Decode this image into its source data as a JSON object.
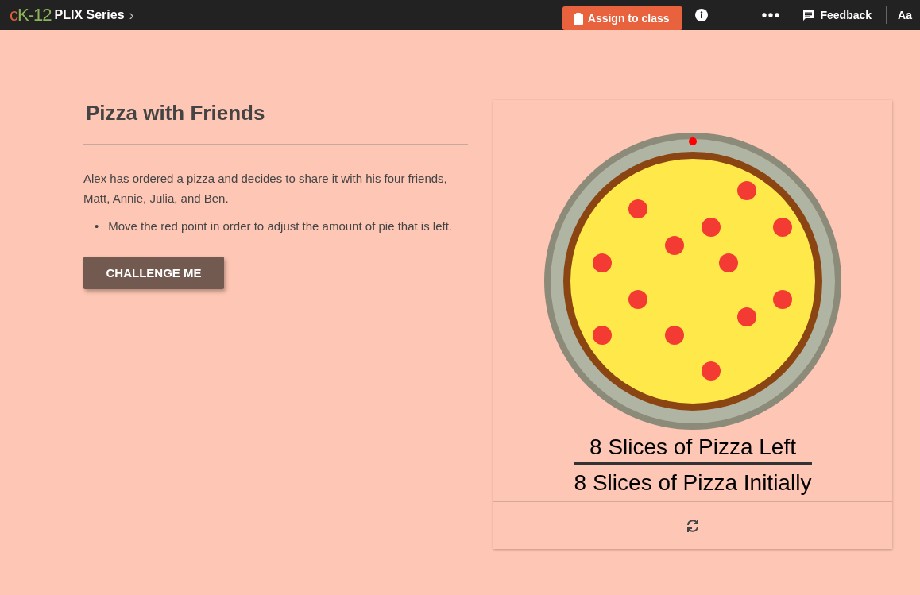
{
  "top_bar": {
    "logo": {
      "first": "c",
      "rest": "K-12"
    },
    "series": "PLIX Series",
    "chevron": "›",
    "assign_button": "Assign to class",
    "feedback": "Feedback",
    "font_button": "Aa"
  },
  "lesson": {
    "title": "Pizza with Friends",
    "intro": "Alex has ordered a pizza and decides to share it with his four friends, Matt, Annie, Julia, and Ben.",
    "bullets": [
      {
        "marker": "•",
        "text": "Move the red point in order to adjust the amount of pie that is left."
      }
    ],
    "challenge_button": "CHALLENGE ME"
  },
  "interactive": {
    "numerator": "8 Slices of Pizza Left",
    "denominator": "8 Slices of Pizza Initially"
  }
}
